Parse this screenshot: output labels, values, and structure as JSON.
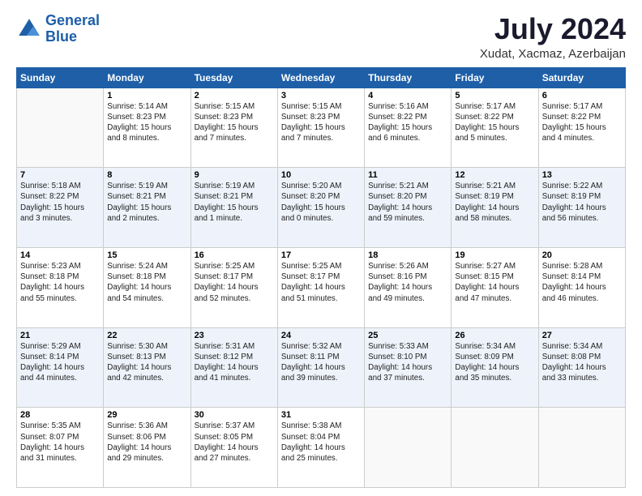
{
  "header": {
    "logo_line1": "General",
    "logo_line2": "Blue",
    "title": "July 2024",
    "subtitle": "Xudat, Xacmaz, Azerbaijan"
  },
  "days_of_week": [
    "Sunday",
    "Monday",
    "Tuesday",
    "Wednesday",
    "Thursday",
    "Friday",
    "Saturday"
  ],
  "weeks": [
    [
      {
        "day": "",
        "info": ""
      },
      {
        "day": "1",
        "info": "Sunrise: 5:14 AM\nSunset: 8:23 PM\nDaylight: 15 hours\nand 8 minutes."
      },
      {
        "day": "2",
        "info": "Sunrise: 5:15 AM\nSunset: 8:23 PM\nDaylight: 15 hours\nand 7 minutes."
      },
      {
        "day": "3",
        "info": "Sunrise: 5:15 AM\nSunset: 8:23 PM\nDaylight: 15 hours\nand 7 minutes."
      },
      {
        "day": "4",
        "info": "Sunrise: 5:16 AM\nSunset: 8:22 PM\nDaylight: 15 hours\nand 6 minutes."
      },
      {
        "day": "5",
        "info": "Sunrise: 5:17 AM\nSunset: 8:22 PM\nDaylight: 15 hours\nand 5 minutes."
      },
      {
        "day": "6",
        "info": "Sunrise: 5:17 AM\nSunset: 8:22 PM\nDaylight: 15 hours\nand 4 minutes."
      }
    ],
    [
      {
        "day": "7",
        "info": "Sunrise: 5:18 AM\nSunset: 8:22 PM\nDaylight: 15 hours\nand 3 minutes."
      },
      {
        "day": "8",
        "info": "Sunrise: 5:19 AM\nSunset: 8:21 PM\nDaylight: 15 hours\nand 2 minutes."
      },
      {
        "day": "9",
        "info": "Sunrise: 5:19 AM\nSunset: 8:21 PM\nDaylight: 15 hours\nand 1 minute."
      },
      {
        "day": "10",
        "info": "Sunrise: 5:20 AM\nSunset: 8:20 PM\nDaylight: 15 hours\nand 0 minutes."
      },
      {
        "day": "11",
        "info": "Sunrise: 5:21 AM\nSunset: 8:20 PM\nDaylight: 14 hours\nand 59 minutes."
      },
      {
        "day": "12",
        "info": "Sunrise: 5:21 AM\nSunset: 8:19 PM\nDaylight: 14 hours\nand 58 minutes."
      },
      {
        "day": "13",
        "info": "Sunrise: 5:22 AM\nSunset: 8:19 PM\nDaylight: 14 hours\nand 56 minutes."
      }
    ],
    [
      {
        "day": "14",
        "info": "Sunrise: 5:23 AM\nSunset: 8:18 PM\nDaylight: 14 hours\nand 55 minutes."
      },
      {
        "day": "15",
        "info": "Sunrise: 5:24 AM\nSunset: 8:18 PM\nDaylight: 14 hours\nand 54 minutes."
      },
      {
        "day": "16",
        "info": "Sunrise: 5:25 AM\nSunset: 8:17 PM\nDaylight: 14 hours\nand 52 minutes."
      },
      {
        "day": "17",
        "info": "Sunrise: 5:25 AM\nSunset: 8:17 PM\nDaylight: 14 hours\nand 51 minutes."
      },
      {
        "day": "18",
        "info": "Sunrise: 5:26 AM\nSunset: 8:16 PM\nDaylight: 14 hours\nand 49 minutes."
      },
      {
        "day": "19",
        "info": "Sunrise: 5:27 AM\nSunset: 8:15 PM\nDaylight: 14 hours\nand 47 minutes."
      },
      {
        "day": "20",
        "info": "Sunrise: 5:28 AM\nSunset: 8:14 PM\nDaylight: 14 hours\nand 46 minutes."
      }
    ],
    [
      {
        "day": "21",
        "info": "Sunrise: 5:29 AM\nSunset: 8:14 PM\nDaylight: 14 hours\nand 44 minutes."
      },
      {
        "day": "22",
        "info": "Sunrise: 5:30 AM\nSunset: 8:13 PM\nDaylight: 14 hours\nand 42 minutes."
      },
      {
        "day": "23",
        "info": "Sunrise: 5:31 AM\nSunset: 8:12 PM\nDaylight: 14 hours\nand 41 minutes."
      },
      {
        "day": "24",
        "info": "Sunrise: 5:32 AM\nSunset: 8:11 PM\nDaylight: 14 hours\nand 39 minutes."
      },
      {
        "day": "25",
        "info": "Sunrise: 5:33 AM\nSunset: 8:10 PM\nDaylight: 14 hours\nand 37 minutes."
      },
      {
        "day": "26",
        "info": "Sunrise: 5:34 AM\nSunset: 8:09 PM\nDaylight: 14 hours\nand 35 minutes."
      },
      {
        "day": "27",
        "info": "Sunrise: 5:34 AM\nSunset: 8:08 PM\nDaylight: 14 hours\nand 33 minutes."
      }
    ],
    [
      {
        "day": "28",
        "info": "Sunrise: 5:35 AM\nSunset: 8:07 PM\nDaylight: 14 hours\nand 31 minutes."
      },
      {
        "day": "29",
        "info": "Sunrise: 5:36 AM\nSunset: 8:06 PM\nDaylight: 14 hours\nand 29 minutes."
      },
      {
        "day": "30",
        "info": "Sunrise: 5:37 AM\nSunset: 8:05 PM\nDaylight: 14 hours\nand 27 minutes."
      },
      {
        "day": "31",
        "info": "Sunrise: 5:38 AM\nSunset: 8:04 PM\nDaylight: 14 hours\nand 25 minutes."
      },
      {
        "day": "",
        "info": ""
      },
      {
        "day": "",
        "info": ""
      },
      {
        "day": "",
        "info": ""
      }
    ]
  ]
}
